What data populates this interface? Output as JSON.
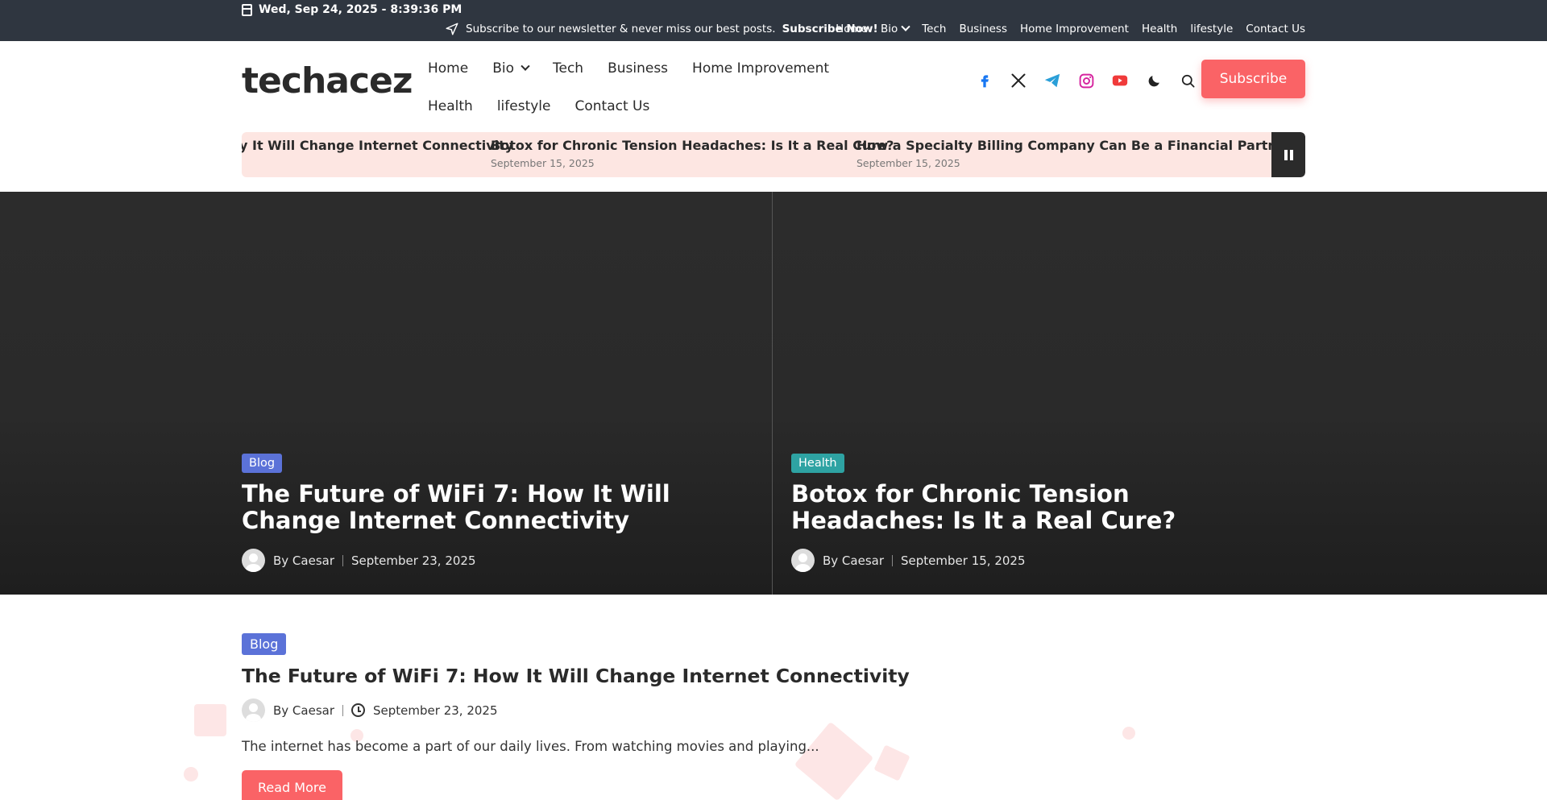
{
  "topbar": {
    "date": "Wed, Sep 24, 2025 - 8:39:36 PM",
    "newsletter_text": "Subscribe to our newsletter & never miss our best posts.",
    "newsletter_cta": "Subscribe Now!",
    "nav": [
      "Home",
      "Bio",
      "Tech",
      "Business",
      "Home Improvement",
      "Health",
      "lifestyle",
      "Contact Us"
    ]
  },
  "header": {
    "logo": "techacez",
    "nav": [
      "Home",
      "Bio",
      "Tech",
      "Business",
      "Home Improvement",
      "Health",
      "lifestyle",
      "Contact Us"
    ],
    "social_icons": [
      "facebook-icon",
      "x-icon",
      "telegram-icon",
      "instagram-icon",
      "youtube-icon"
    ],
    "subscribe_label": "Subscribe"
  },
  "ticker": {
    "items": [
      {
        "title": "y It Will Change Internet Connectivity",
        "date": ""
      },
      {
        "title": "Botox for Chronic Tension Headaches: Is It a Real Cure?",
        "date": "September 15, 2025"
      },
      {
        "title": "How a Specialty Billing Company Can Be a Financial Partner for Yo",
        "date": "September 15, 2025"
      }
    ]
  },
  "hero": {
    "posts": [
      {
        "category": "Blog",
        "title": "The Future of WiFi 7: How It Will Change Internet Connectivity",
        "author": "By Caesar",
        "date": "September 23, 2025"
      },
      {
        "category": "Health",
        "title": "Botox for Chronic Tension Headaches: Is It a Real Cure?",
        "author": "By Caesar",
        "date": "September 15, 2025"
      }
    ]
  },
  "featured": {
    "category": "Blog",
    "title": "The Future of WiFi 7: How It Will Change Internet Connectivity",
    "author": "By Caesar",
    "date": "September 23, 2025",
    "excerpt": "The internet has become a part of our daily lives. From watching movies and playing...",
    "read_more": "Read More"
  },
  "colors": {
    "accent": "#fa6366",
    "topbar": "#2f3640",
    "blog_badge": "#5b72d8",
    "health_badge": "#2ea3a3",
    "ticker_bg": "#fde6e2"
  }
}
